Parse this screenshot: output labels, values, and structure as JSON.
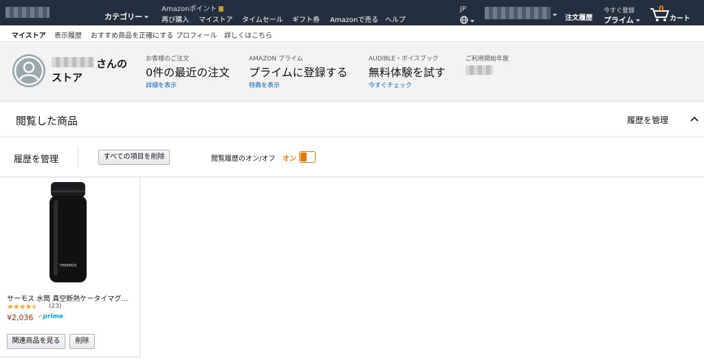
{
  "header": {
    "category_label": "カテゴリー",
    "points_label": "Amazonポイント",
    "links": [
      "再び購入",
      "マイストア",
      "タイムセール",
      "ギフト券",
      "Amazonで売る",
      "ヘルプ"
    ],
    "lang": "JP",
    "orders": "注文履歴",
    "prime_top": "今すぐ登録",
    "prime_bottom": "プライム",
    "cart_count": "0",
    "cart_label": "カート"
  },
  "subnav": [
    "マイストア",
    "表示履歴",
    "おすすめ商品を正確にする",
    "プロフィール",
    "詳しくはこちら"
  ],
  "profile": {
    "name_suffix": "さんの",
    "store_word": "ストア",
    "stats": [
      {
        "label": "お客様のご注文",
        "value": "0件の最近の注文",
        "link": "詳細を表示"
      },
      {
        "label": "AMAZON プライム",
        "value": "プライムに登録する",
        "link": "特典を表示"
      },
      {
        "label": "AUDIBLE・ボイスブック",
        "value": "無料体験を試す",
        "link": "今すぐチェック"
      },
      {
        "label": "ご利用開始年度",
        "value": "",
        "link": ""
      }
    ]
  },
  "section": {
    "title": "閲覧した商品",
    "manage_link": "履歴を管理"
  },
  "toolbar": {
    "title": "履歴を管理",
    "delete_all": "すべての項目を削除",
    "toggle_label": "閲覧履歴のオン/オフ",
    "toggle_state": "オン"
  },
  "product": {
    "brand_text": "THERMOS",
    "title": "サーモス 水筒 真空断熱ケータイマグ…",
    "rating": 4.5,
    "review_count": "(23)",
    "price": "¥2,036",
    "prime": "prime",
    "related_button": "関連商品を見る",
    "delete_button": "削除"
  },
  "colors": {
    "nav_bg": "#232f3e",
    "accent_orange": "#e77600",
    "link_blue": "#0066c0",
    "price_red": "#b12704",
    "star": "#ffa41c",
    "prime_blue": "#00a8e1"
  }
}
